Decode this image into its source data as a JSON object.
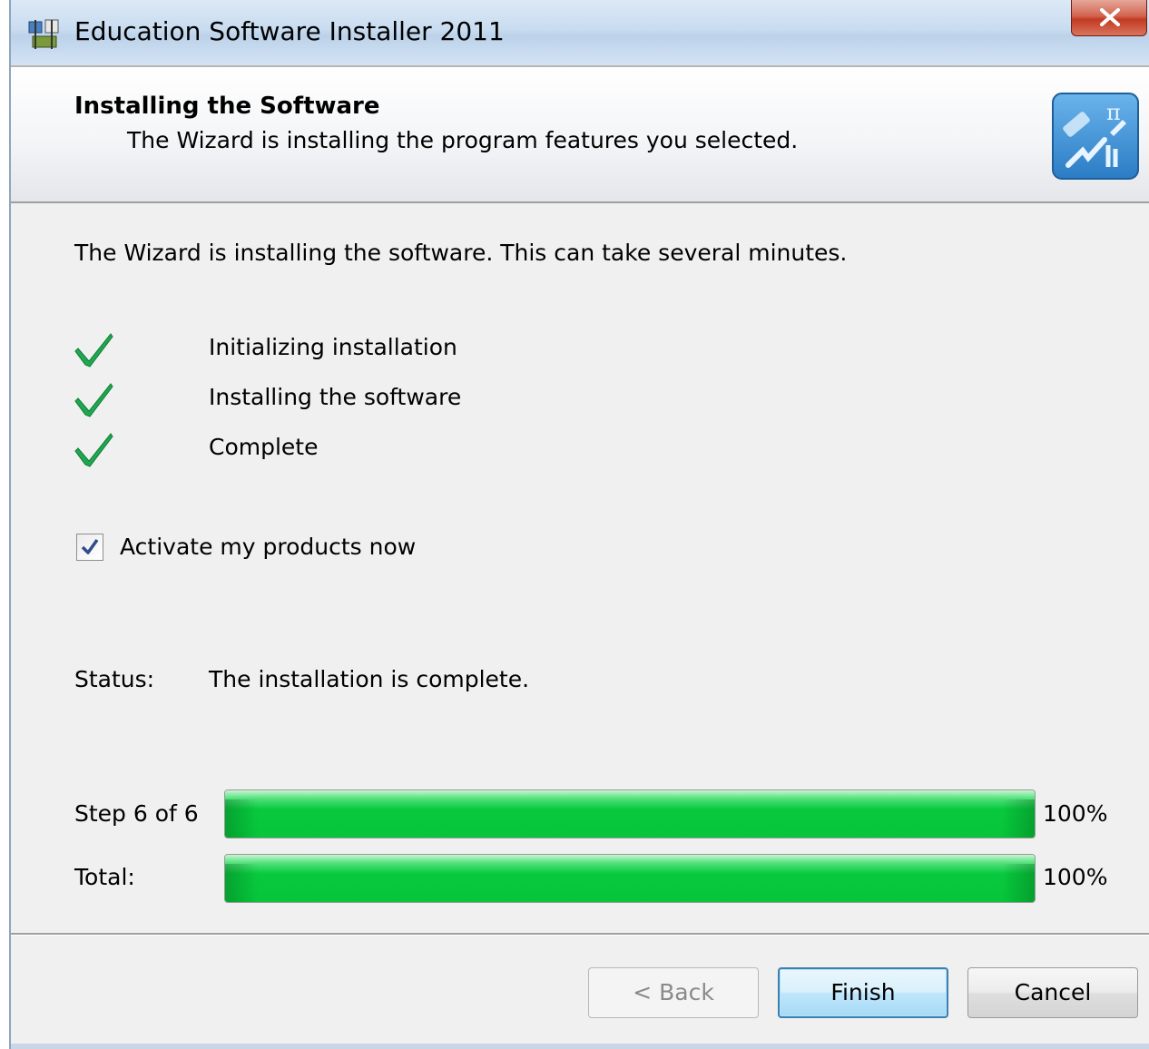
{
  "window": {
    "title": "Education Software Installer 2011",
    "close_glyph": "X"
  },
  "header": {
    "title": "Installing the Software",
    "subtitle": "The Wizard is installing the program features you selected."
  },
  "intro_text": "The Wizard is installing the software. This can take several minutes.",
  "steps": [
    {
      "label": "Initializing installation",
      "icon": "check-icon",
      "done": true
    },
    {
      "label": "Installing the software",
      "icon": "check-icon",
      "done": true
    },
    {
      "label": "Complete",
      "icon": "check-icon",
      "done": true
    }
  ],
  "activate": {
    "label": "Activate my products now",
    "checked": true
  },
  "status": {
    "label": "Status:",
    "value": "The installation is complete."
  },
  "progress": [
    {
      "label": "Step 6 of 6",
      "percent_text": "100%",
      "fraction": 1.0
    },
    {
      "label": "Total:",
      "percent_text": "100%",
      "fraction": 1.0
    }
  ],
  "buttons": {
    "back": "< Back",
    "finish": "Finish",
    "cancel": "Cancel"
  },
  "colors": {
    "progress_green": "#06c53a",
    "check_green": "#1a9a4a",
    "default_button_border": "#3c7fb1"
  }
}
